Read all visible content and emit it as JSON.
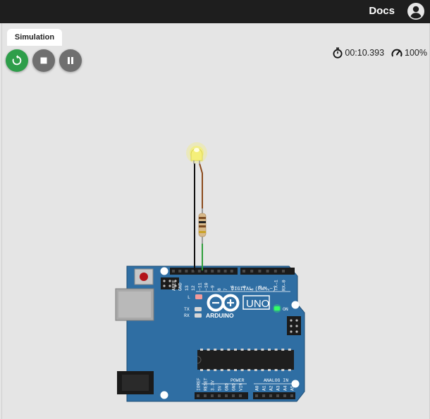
{
  "header": {
    "docs_label": "Docs"
  },
  "tabs": [
    {
      "label": "Simulation"
    }
  ],
  "controls": {
    "restart": "restart-icon",
    "stop": "stop-icon",
    "pause": "pause-icon"
  },
  "status": {
    "elapsed_time": "00:10.393",
    "speed": "100%"
  },
  "board": {
    "brand": "ARDUINO",
    "model": "UNO",
    "digital_label": "DIGITAL (PWM ~)",
    "power_label": "POWER",
    "analog_label": "ANALOG IN",
    "on_label": "ON",
    "l_label": "L",
    "tx_label": "TX",
    "rx_label": "RX",
    "digital_pins": [
      "AREF",
      "GND",
      "13",
      "12",
      "~11",
      "~10",
      "~9",
      "8",
      "7",
      "~6",
      "~5",
      "4",
      "~3",
      "2",
      "TX→1",
      "RX←0"
    ],
    "power_pins": [
      "IOREF",
      "RESET",
      "3.3V",
      "5V",
      "GND",
      "GND",
      "VIN"
    ],
    "analog_pins": [
      "A0",
      "A1",
      "A2",
      "A3",
      "A4",
      "A5"
    ]
  },
  "colors": {
    "led_on": "#f6f060",
    "board": "#2f6ea3",
    "resistor": "#d7b98a",
    "wire_anode": "#8b4a1c",
    "wire_cathode": "#111111",
    "wire_pin13": "#2e9e3a",
    "power_led": "#33ff66"
  }
}
